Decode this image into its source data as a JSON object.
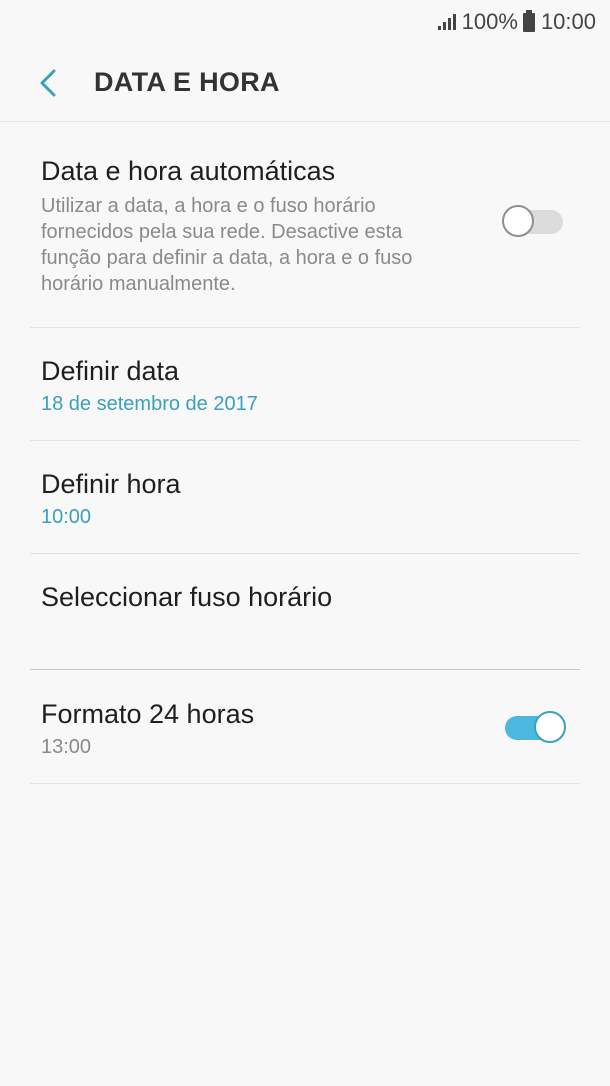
{
  "status_bar": {
    "battery_percent": "100%",
    "time": "10:00",
    "icons": [
      "signal-icon",
      "battery-icon"
    ]
  },
  "app_bar": {
    "title": "DATA E HORA",
    "back_icon": "chevron-left-icon"
  },
  "settings": {
    "auto_datetime": {
      "title": "Data e hora automáticas",
      "description": "Utilizar a data, a hora e o fuso horário fornecidos pela sua rede. Desactive esta função para definir a data, a hora e o fuso horário manualmente.",
      "enabled": false
    },
    "set_date": {
      "title": "Definir data",
      "value": "18 de setembro de 2017"
    },
    "set_time": {
      "title": "Definir hora",
      "value": "10:00"
    },
    "timezone": {
      "title": "Seleccionar fuso horário"
    },
    "format_24h": {
      "title": "Formato 24 horas",
      "value": "13:00",
      "enabled": true
    }
  },
  "colors": {
    "accent": "#3a9fc0",
    "toggle_on": "#4cb8dd",
    "background": "#f8f8f8"
  }
}
